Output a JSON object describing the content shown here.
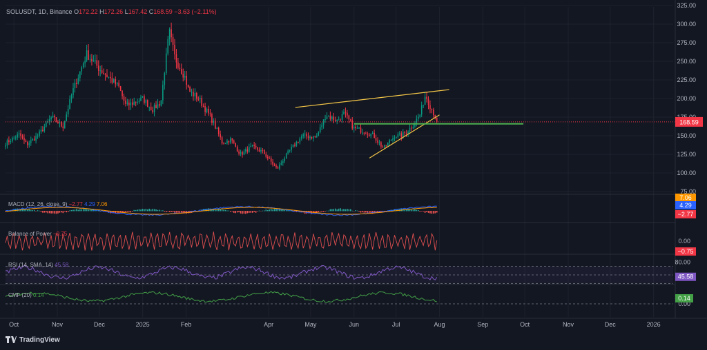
{
  "header": {
    "symbol": "SOLUSDT, 1D, Binance",
    "open_label": "O",
    "open": "172.22",
    "high_label": "H",
    "high": "172.26",
    "low_label": "L",
    "low": "167.42",
    "close_label": "C",
    "close": "168.59",
    "change": "−3.63 (−2.11%)"
  },
  "indicators": {
    "macd": {
      "label": "MACD (12, 26, close, 9)",
      "v1": "−2.77",
      "v2": "4.29",
      "v3": "7.06"
    },
    "bop": {
      "label": "Balance of Power",
      "value": "−0.75"
    },
    "rsi": {
      "label": "RSI (14, SMA, 14)",
      "value": "45.58"
    },
    "cmf": {
      "label": "CMF (20)",
      "value": "0.14"
    }
  },
  "footer": {
    "brand": "TradingView"
  },
  "colors": {
    "background": "#131722",
    "up": "#089981",
    "down": "#f23645",
    "trendline": "#f7c948",
    "support": "#4caf50",
    "rsi": "#7e57c2",
    "cmf": "#43a047",
    "macd": "#2962ff",
    "signal": "#ff9800"
  },
  "chart_data": {
    "type": "candlestick",
    "symbol": "SOLUSDT",
    "interval": "1D",
    "x_ticks": [
      "Oct",
      "Nov",
      "Dec",
      "2025",
      "Feb",
      "Apr",
      "May",
      "Jun",
      "Jul",
      "Aug",
      "Sep",
      "Oct",
      "Nov",
      "Dec",
      "2026"
    ],
    "y_ticks": [
      "75.00",
      "100.00",
      "125.00",
      "150.00",
      "175.00",
      "200.00",
      "225.00",
      "250.00",
      "275.00",
      "300.00",
      "325.00"
    ],
    "ylim": [
      75,
      325
    ],
    "last_price": "168.59",
    "price_path": [
      [
        "2024-09-25",
        140
      ],
      [
        "2024-10-05",
        152
      ],
      [
        "2024-10-10",
        138
      ],
      [
        "2024-10-18",
        150
      ],
      [
        "2024-10-28",
        175
      ],
      [
        "2024-11-05",
        162
      ],
      [
        "2024-11-12",
        210
      ],
      [
        "2024-11-22",
        260
      ],
      [
        "2024-12-01",
        240
      ],
      [
        "2024-12-08",
        228
      ],
      [
        "2024-12-15",
        215
      ],
      [
        "2024-12-20",
        190
      ],
      [
        "2025-01-01",
        200
      ],
      [
        "2025-01-08",
        185
      ],
      [
        "2025-01-14",
        195
      ],
      [
        "2025-01-18",
        260
      ],
      [
        "2025-01-20",
        290
      ],
      [
        "2025-01-24",
        255
      ],
      [
        "2025-01-31",
        230
      ],
      [
        "2025-02-03",
        210
      ],
      [
        "2025-02-10",
        200
      ],
      [
        "2025-02-20",
        170
      ],
      [
        "2025-02-27",
        140
      ],
      [
        "2025-03-05",
        145
      ],
      [
        "2025-03-12",
        125
      ],
      [
        "2025-03-20",
        135
      ],
      [
        "2025-03-28",
        128
      ],
      [
        "2025-04-07",
        105
      ],
      [
        "2025-04-15",
        128
      ],
      [
        "2025-04-25",
        150
      ],
      [
        "2025-05-05",
        148
      ],
      [
        "2025-05-12",
        178
      ],
      [
        "2025-05-20",
        170
      ],
      [
        "2025-05-25",
        180
      ],
      [
        "2025-06-01",
        160
      ],
      [
        "2025-06-10",
        155
      ],
      [
        "2025-06-15",
        150
      ],
      [
        "2025-06-22",
        133
      ],
      [
        "2025-06-30",
        150
      ],
      [
        "2025-07-05",
        150
      ],
      [
        "2025-07-12",
        162
      ],
      [
        "2025-07-18",
        178
      ],
      [
        "2025-07-22",
        205
      ],
      [
        "2025-07-26",
        188
      ],
      [
        "2025-07-31",
        168.59
      ]
    ],
    "annotations": [
      {
        "type": "trendline",
        "from": [
          "2025-04-20",
          188
        ],
        "to": [
          "2025-08-08",
          212
        ]
      },
      {
        "type": "trendline",
        "from": [
          "2025-06-12",
          120
        ],
        "to": [
          "2025-08-01",
          178
        ]
      },
      {
        "type": "horizontal",
        "from": "2025-06-01",
        "to": "2025-09-30",
        "y": 166
      }
    ],
    "macd_values": {
      "macd": -2.77,
      "signal": 4.29,
      "histogram": 7.06
    },
    "bop_value": -0.75,
    "bop_ticks": [
      "0.00"
    ],
    "rsi_value": 45.58,
    "rsi_ticks": [
      "80.00"
    ],
    "cmf_value": 0.14,
    "cmf_ticks": [
      "0.00"
    ]
  }
}
